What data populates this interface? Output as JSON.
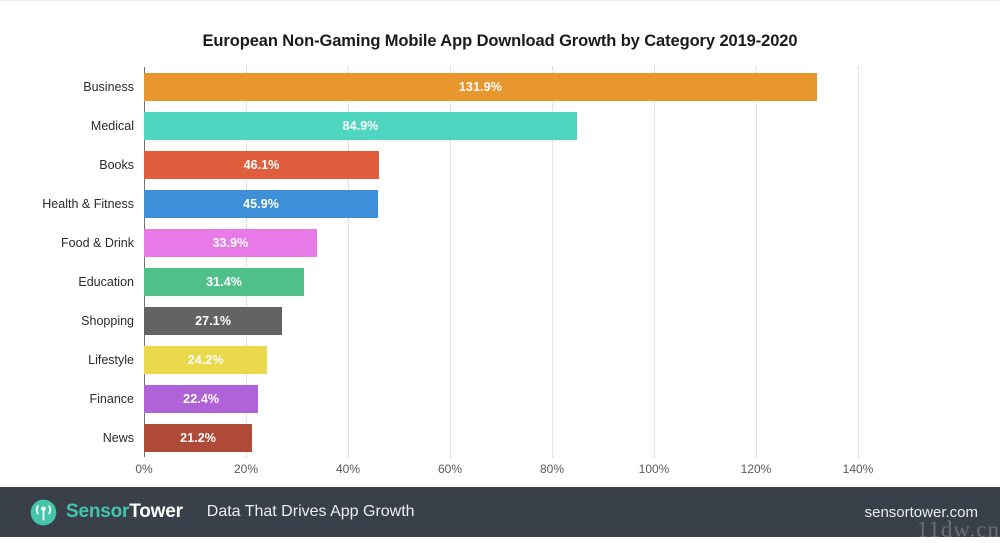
{
  "chart_data": {
    "type": "bar",
    "orientation": "horizontal",
    "title": "European Non-Gaming Mobile App Download Growth by Category 2019-2020",
    "xlabel": "",
    "ylabel": "",
    "xlim": [
      0,
      140
    ],
    "grid": true,
    "legend": false,
    "categories": [
      "Business",
      "Medical",
      "Books",
      "Health & Fitness",
      "Food & Drink",
      "Education",
      "Shopping",
      "Lifestyle",
      "Finance",
      "News"
    ],
    "values": [
      131.9,
      84.9,
      46.1,
      45.9,
      33.9,
      31.4,
      27.1,
      24.2,
      22.4,
      21.2
    ],
    "value_labels": [
      "131.9%",
      "84.9%",
      "46.1%",
      "45.9%",
      "33.9%",
      "31.4%",
      "27.1%",
      "24.2%",
      "22.4%",
      "21.2%"
    ],
    "colors": [
      "#e8972e",
      "#4ed6c0",
      "#e05e3e",
      "#3d8fd8",
      "#e87ae8",
      "#4fc08a",
      "#636363",
      "#e8d84a",
      "#b063d8",
      "#b04a38"
    ],
    "xticks": [
      0,
      20,
      40,
      60,
      80,
      100,
      120,
      140
    ],
    "xtick_labels": [
      "0%",
      "20%",
      "40%",
      "60%",
      "80%",
      "100%",
      "120%",
      "140%"
    ]
  },
  "footer": {
    "logo_icon": "sensor-tower-broadcast-icon",
    "brand_first": "Sensor",
    "brand_second": "Tower",
    "tagline": "Data That Drives App Growth",
    "site_url": "sensortower.com",
    "watermark": "11dw.cn"
  },
  "theme": {
    "background": "#ffffff",
    "footer_background": "#3a4049",
    "brand_accent": "#45c5ab",
    "axis_color": "#6f7378",
    "gridline_color": "#c9c9c9",
    "title_color": "#1b1b1b"
  }
}
